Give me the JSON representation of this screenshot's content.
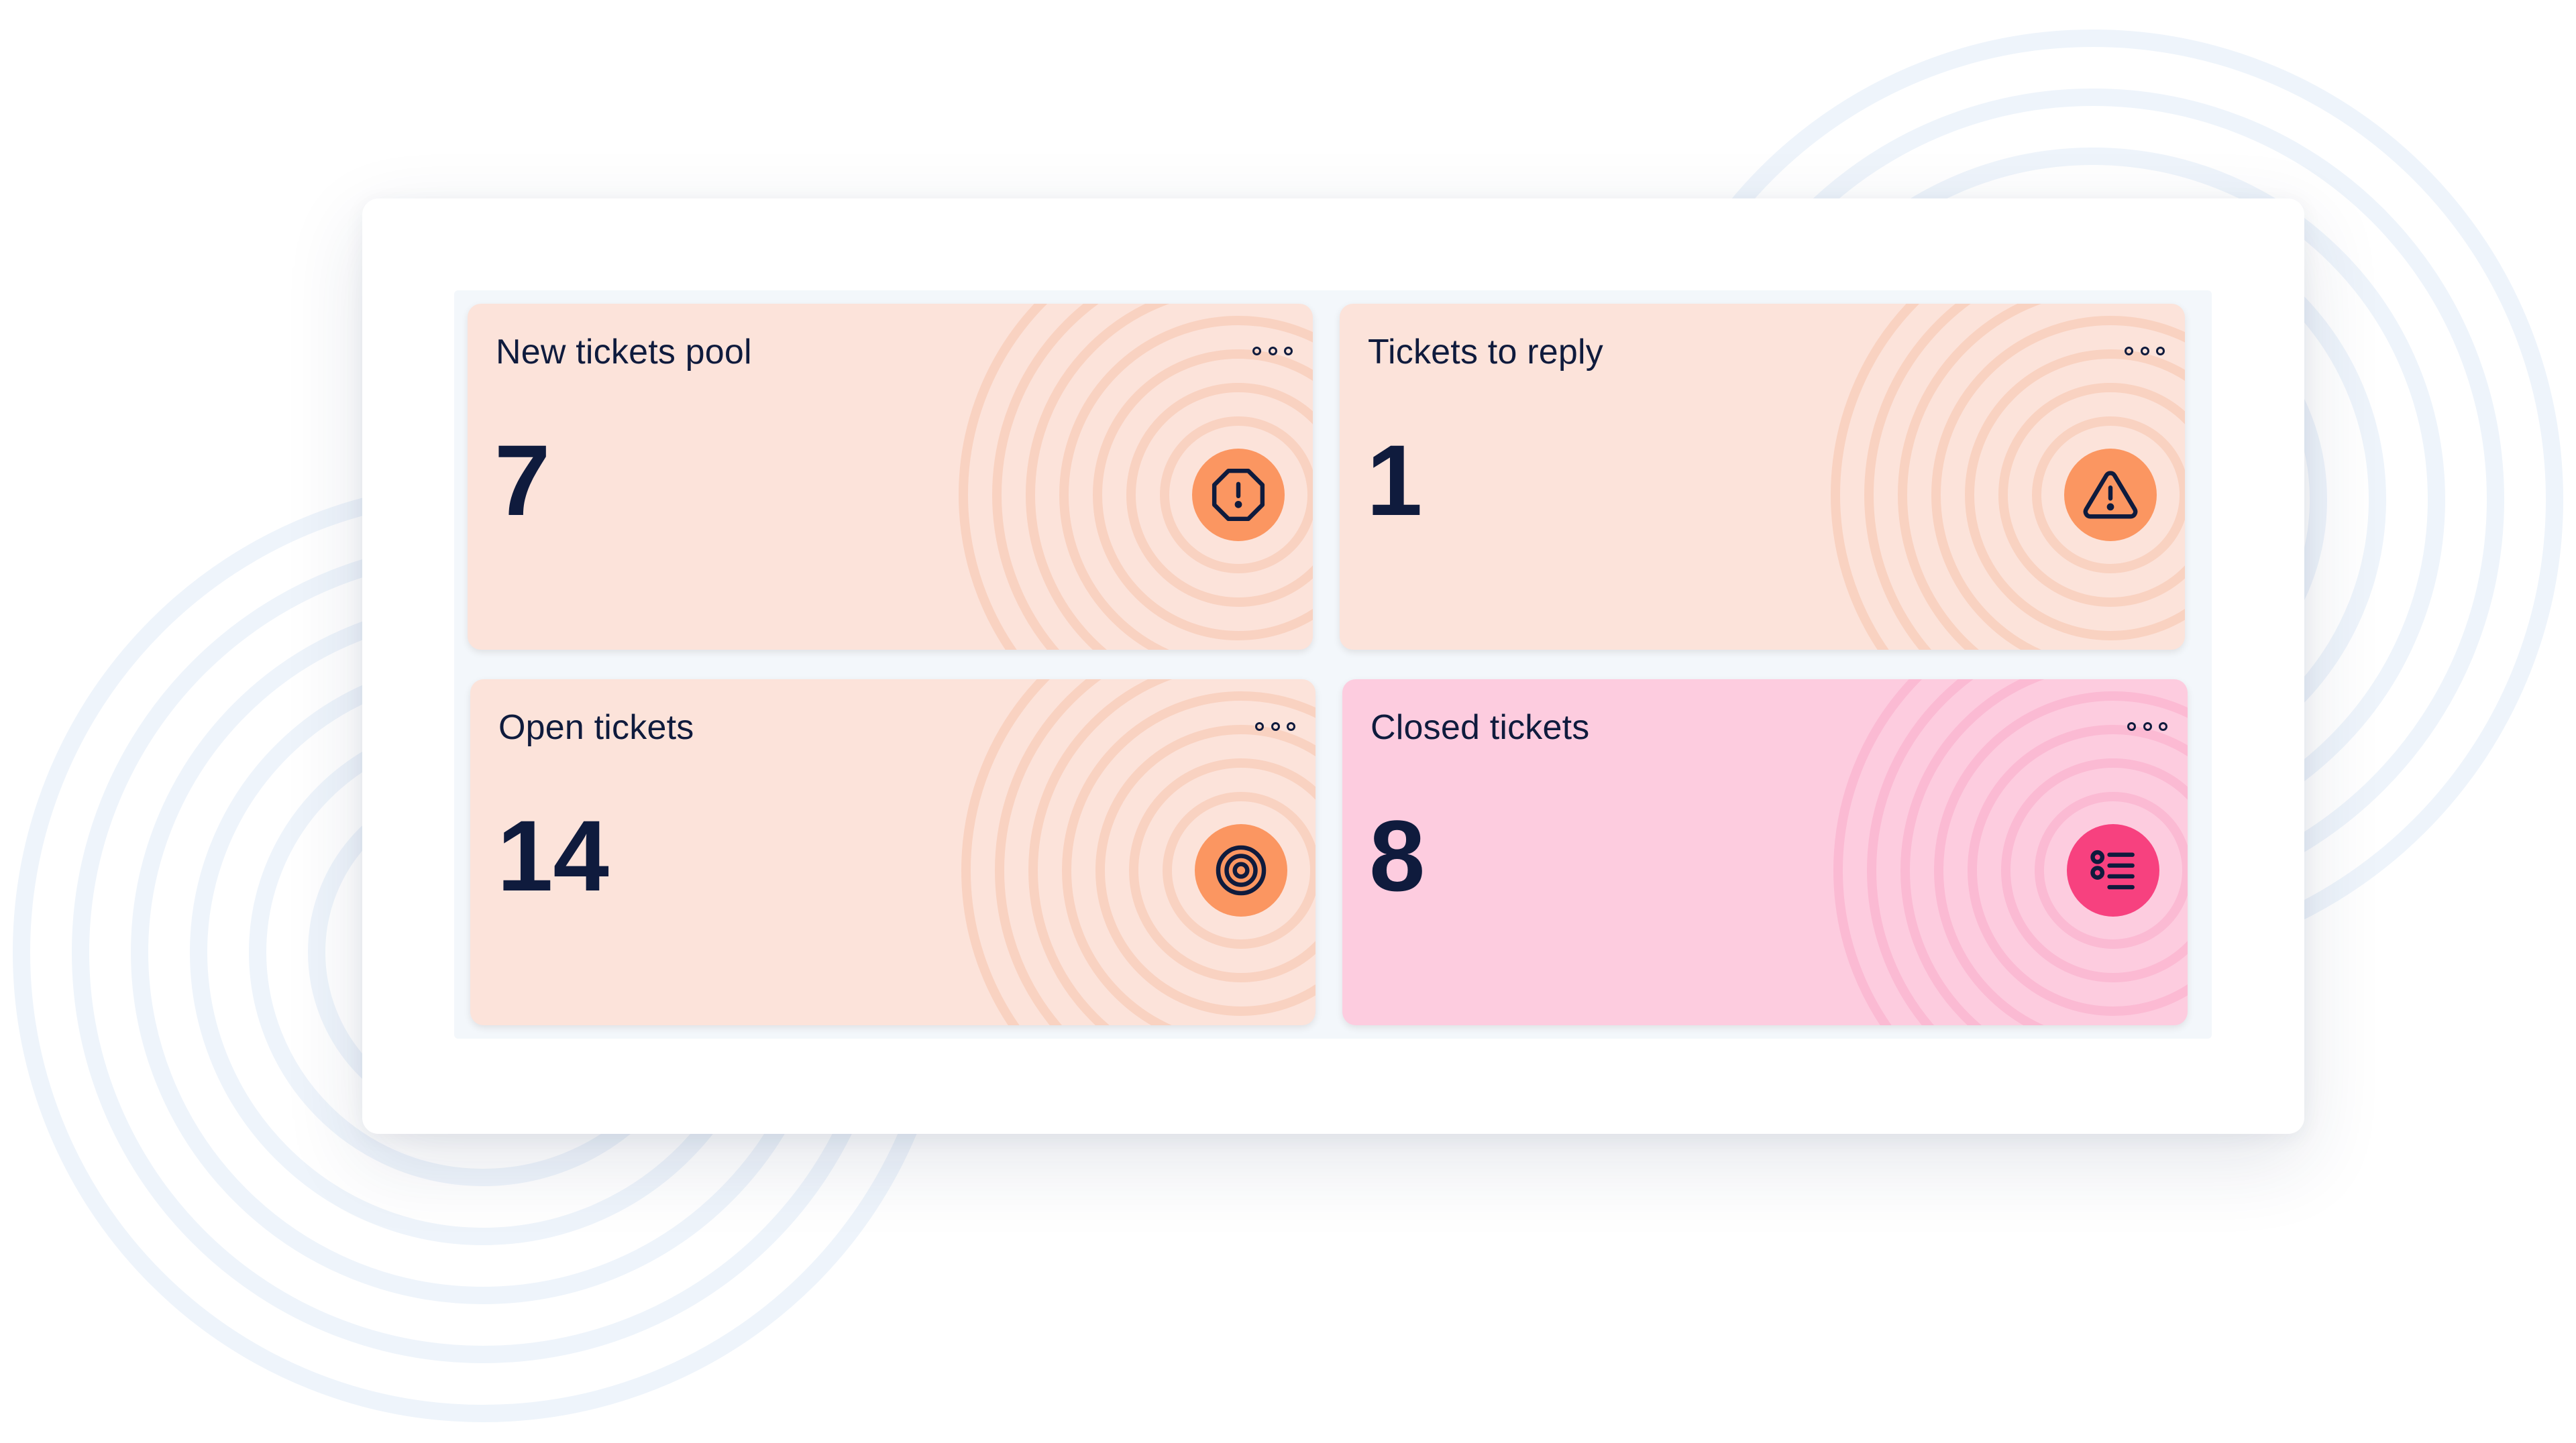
{
  "colors": {
    "card_orange_bg": "#fce3da",
    "card_pink_bg": "#fdccdf",
    "badge_orange": "#fb9661",
    "badge_pink": "#f7417f",
    "text_dark": "#0f1b3d"
  },
  "cards": [
    {
      "title": "New tickets pool",
      "value": "7",
      "icon": "octagon-alert-icon",
      "theme": "orange"
    },
    {
      "title": "Tickets to reply",
      "value": "1",
      "icon": "triangle-warning-icon",
      "theme": "orange"
    },
    {
      "title": "Open tickets",
      "value": "14",
      "icon": "target-icon",
      "theme": "orange"
    },
    {
      "title": "Closed tickets",
      "value": "8",
      "icon": "list-icon",
      "theme": "pink"
    }
  ]
}
